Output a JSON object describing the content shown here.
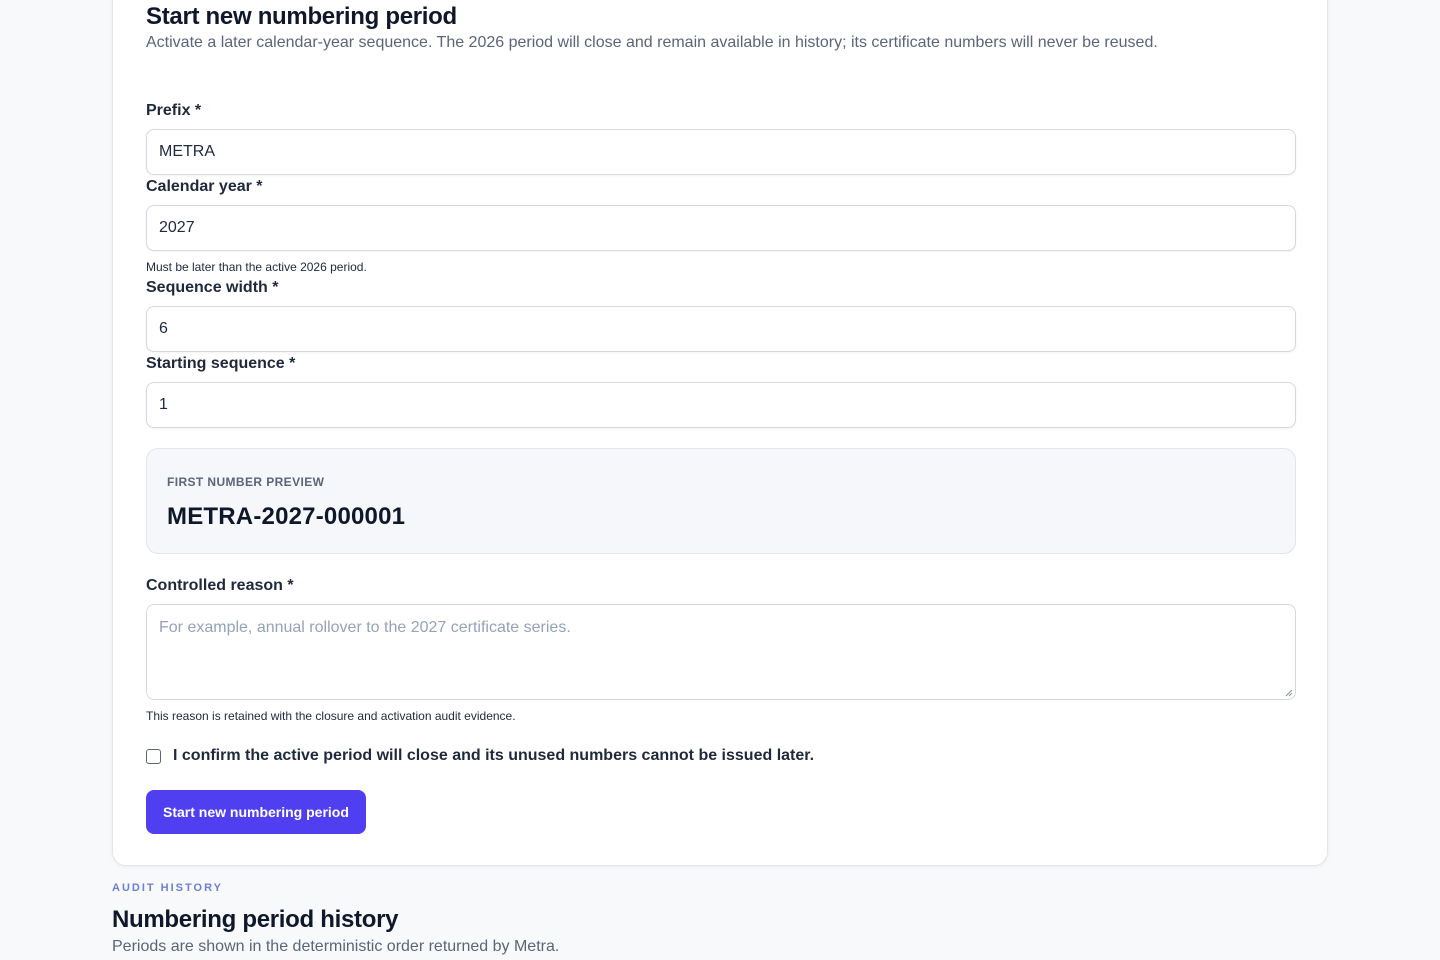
{
  "form": {
    "title": "Start new numbering period",
    "description": "Activate a later calendar-year sequence. The 2026 period will close and remain available in history; its certificate numbers will never be reused.",
    "fields": {
      "prefix": {
        "label": "Prefix *",
        "value": "METRA"
      },
      "calendar_year": {
        "label": "Calendar year *",
        "value": "2027",
        "hint": "Must be later than the active 2026 period."
      },
      "sequence_width": {
        "label": "Sequence width *",
        "value": "6"
      },
      "starting_sequence": {
        "label": "Starting sequence *",
        "value": "1"
      }
    },
    "preview": {
      "label": "FIRST NUMBER PREVIEW",
      "value": "METRA-2027-000001"
    },
    "reason": {
      "label": "Controlled reason *",
      "placeholder": "For example, annual rollover to the 2027 certificate series.",
      "value": "",
      "hint": "This reason is retained with the closure and activation audit evidence."
    },
    "confirm": {
      "label": "I confirm the active period will close and its unused numbers cannot be issued later.",
      "checked": false
    },
    "submit_label": "Start new numbering period"
  },
  "history": {
    "eyebrow": "AUDIT HISTORY",
    "title": "Numbering period history",
    "description": "Periods are shown in the deterministic order returned by Metra."
  },
  "colors": {
    "accent": "#4f3ff0",
    "eyebrow": "#6b7fd7",
    "background": "#f8f9fb"
  }
}
